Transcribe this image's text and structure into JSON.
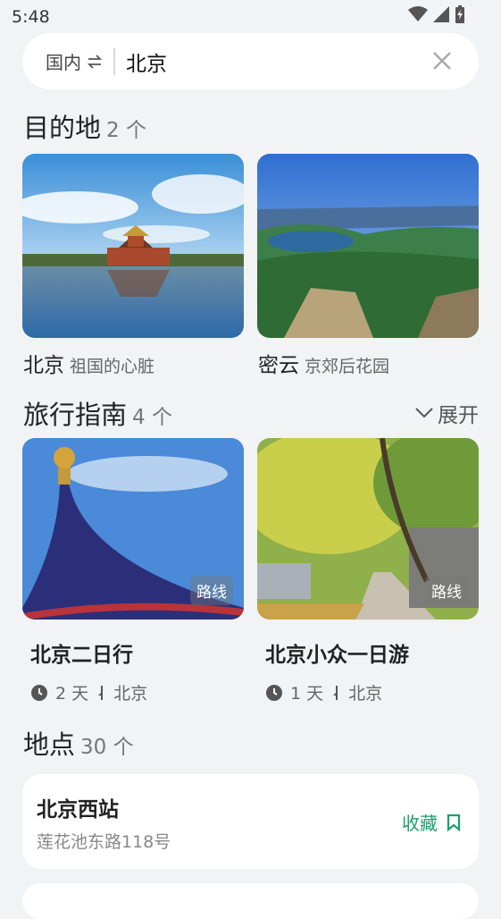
{
  "status": {
    "time": "5:48"
  },
  "search": {
    "scope": "国内",
    "query": "北京"
  },
  "destinations": {
    "title": "目的地",
    "count": "2 个",
    "items": [
      {
        "name": "北京",
        "subtitle": "祖国的心脏"
      },
      {
        "name": "密云",
        "subtitle": "京郊后花园"
      }
    ]
  },
  "guides": {
    "title": "旅行指南",
    "count": "4 个",
    "expand": "展开",
    "items": [
      {
        "badge": "路线",
        "title": "北京二日行",
        "days": "2 天",
        "location": "北京"
      },
      {
        "badge": "路线",
        "title": "北京小众一日游",
        "days": "1 天",
        "location": "北京"
      }
    ]
  },
  "places": {
    "title": "地点",
    "count": "30 个",
    "items": [
      {
        "name": "北京西站",
        "address": "莲花池东路118号",
        "action": "收藏"
      }
    ]
  },
  "colors": {
    "accent": "#19a06e",
    "background": "#f2f3f5"
  }
}
